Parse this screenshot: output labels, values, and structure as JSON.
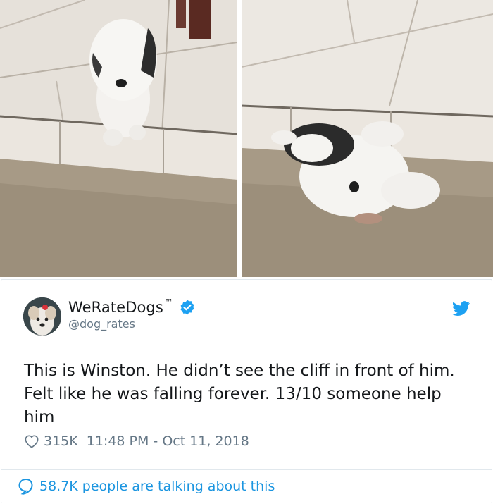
{
  "tweet": {
    "display_name": "WeRateDogs",
    "trademark": "™",
    "handle": "@dog_rates",
    "text": "This is Winston. He didn’t see the cliff in front of him. Felt like he was falling forever. 13/10 someone help him",
    "likes": "315K",
    "timestamp": "11:48 PM - Oct 11, 2018",
    "talking": "58.7K people are talking about this"
  },
  "colors": {
    "text": "#14171a",
    "secondary": "#657786",
    "twitter_blue": "#1da1f2",
    "link_blue": "#1b95e0",
    "border": "#e1e8ed"
  },
  "icons": {
    "verified": "verified-badge-icon",
    "bird": "twitter-bird-icon",
    "heart": "heart-icon",
    "comment": "speech-bubble-icon"
  }
}
